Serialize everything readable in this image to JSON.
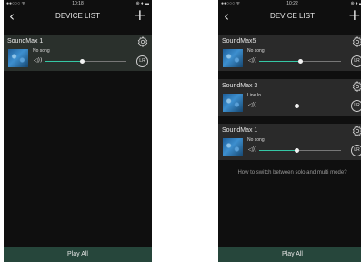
{
  "screens": [
    {
      "status": {
        "left": "●●○○○ ᯤ",
        "time": "10:18",
        "right": "⊕ ♦ ▬"
      },
      "nav": {
        "back": "‹",
        "title": "DEVICE LIST",
        "add": "+"
      },
      "devices": [
        {
          "name": "SoundMax 1",
          "song": "No song",
          "volume": 0.45,
          "lr": "LR",
          "speaker_icon": "speaker-icon"
        }
      ],
      "play_all": "Play All"
    },
    {
      "status": {
        "left": "●●○○○ ᯤ",
        "time": "10:22",
        "right": "⊕ ♦ ▬"
      },
      "nav": {
        "back": "‹",
        "title": "DEVICE LIST",
        "add": "+"
      },
      "devices": [
        {
          "name": "SoundMax5",
          "song": "No song",
          "volume": 0.5,
          "lr": "LR",
          "speaker_icon": "speaker-icon"
        },
        {
          "name": "SoundMax 3",
          "song": "Line In",
          "volume": 0.45,
          "lr": "LR",
          "speaker_icon": "speaker-icon"
        },
        {
          "name": "SoundMax 1",
          "song": "No song",
          "volume": 0.45,
          "lr": "LR",
          "speaker_icon": "speaker-icon"
        }
      ],
      "help_text": "How to switch between solo and multi mode?",
      "play_all": "Play All"
    }
  ],
  "colors": {
    "accent": "#35c7a5",
    "background": "#0f0f0f",
    "card": "#2a2a2a",
    "play_bar": "#26463b"
  }
}
